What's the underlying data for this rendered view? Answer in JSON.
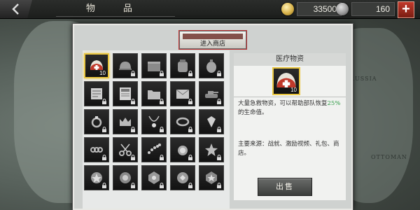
{
  "topbar": {
    "title": "物 品",
    "gold": "33500",
    "medals": "160",
    "plus_label": "+"
  },
  "map_labels": {
    "russia": "RUSSIA",
    "ottoman": "OTTOMAN"
  },
  "shop": {
    "label": "进入商店"
  },
  "items": [
    {
      "name": "medkit",
      "count": "10",
      "selected": true,
      "locked": false
    },
    {
      "name": "helmet",
      "count": "",
      "selected": false,
      "locked": true
    },
    {
      "name": "ammo-crate",
      "count": "",
      "selected": false,
      "locked": true
    },
    {
      "name": "backpack",
      "count": "",
      "selected": false,
      "locked": true
    },
    {
      "name": "canteen",
      "count": "",
      "selected": false,
      "locked": true
    },
    {
      "name": "letter",
      "count": "",
      "selected": false,
      "locked": true
    },
    {
      "name": "newspaper",
      "count": "",
      "selected": false,
      "locked": true
    },
    {
      "name": "folder",
      "count": "",
      "selected": false,
      "locked": true
    },
    {
      "name": "envelope",
      "count": "",
      "selected": false,
      "locked": true
    },
    {
      "name": "tank-model",
      "count": "",
      "selected": false,
      "locked": true
    },
    {
      "name": "ring",
      "count": "",
      "selected": false,
      "locked": true
    },
    {
      "name": "crown",
      "count": "",
      "selected": false,
      "locked": true
    },
    {
      "name": "necklace",
      "count": "",
      "selected": false,
      "locked": true
    },
    {
      "name": "bracelet",
      "count": "",
      "selected": false,
      "locked": true
    },
    {
      "name": "gem",
      "count": "",
      "selected": false,
      "locked": true
    },
    {
      "name": "chain",
      "count": "",
      "selected": false,
      "locked": true
    },
    {
      "name": "scissors",
      "count": "",
      "selected": false,
      "locked": true
    },
    {
      "name": "beads",
      "count": "",
      "selected": false,
      "locked": true
    },
    {
      "name": "medal-round",
      "count": "",
      "selected": false,
      "locked": true
    },
    {
      "name": "star-badge",
      "count": "",
      "selected": false,
      "locked": true
    },
    {
      "name": "badge-1",
      "count": "",
      "selected": false,
      "locked": true
    },
    {
      "name": "badge-2",
      "count": "",
      "selected": false,
      "locked": true
    },
    {
      "name": "badge-3",
      "count": "",
      "selected": false,
      "locked": true
    },
    {
      "name": "badge-4",
      "count": "",
      "selected": false,
      "locked": true
    },
    {
      "name": "badge-5",
      "count": "",
      "selected": false,
      "locked": true
    }
  ],
  "detail": {
    "header": "医疗物资",
    "count": "10",
    "desc_prefix": "大量急救物资，可以帮助部队恢复",
    "desc_highlight": "25%",
    "desc_suffix": "的生命值。",
    "source": "主要来源：战就、激励视频、礼包、商店。",
    "sell_label": "出售"
  },
  "colors": {
    "highlight": "#2e9b45",
    "selection": "#e9c640",
    "plus": "#c0392b"
  }
}
